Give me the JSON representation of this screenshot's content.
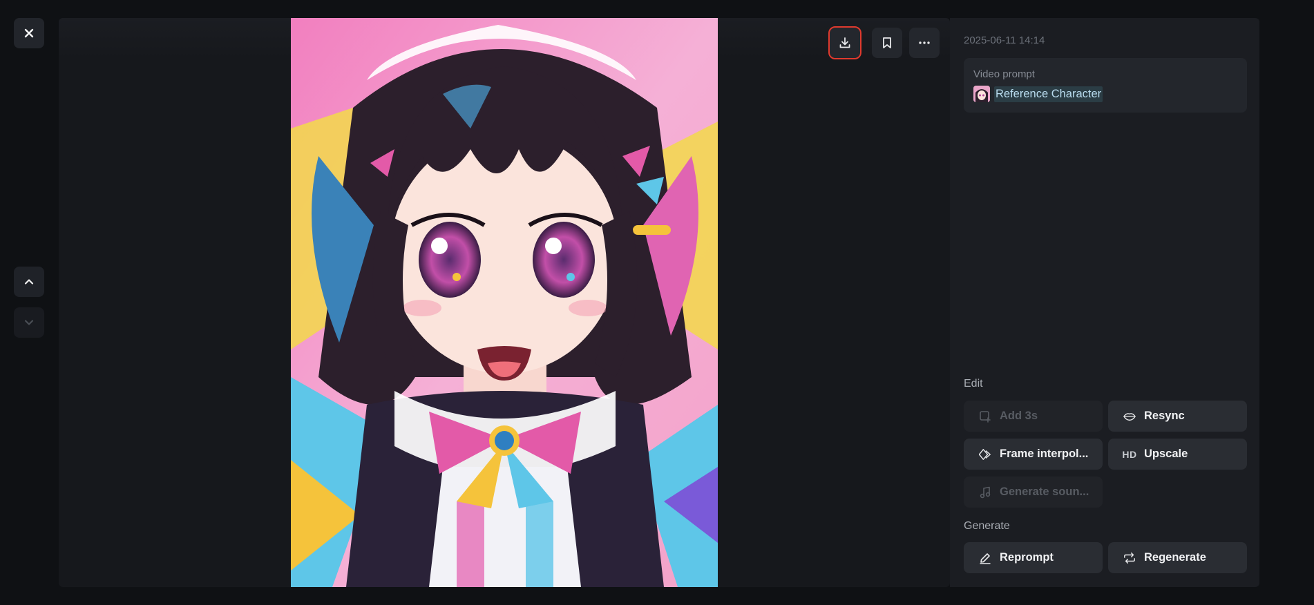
{
  "window": {
    "close_icon": "close-icon",
    "nav_up_icon": "chevron-up-icon",
    "nav_down_icon": "chevron-down-icon"
  },
  "toolbar": {
    "download_icon": "download-icon",
    "bookmark_icon": "bookmark-icon",
    "more_icon": "more-horizontal-icon",
    "highlight_color": "#e03a2e"
  },
  "panel": {
    "timestamp": "2025-06-11 14:14",
    "prompt": {
      "label": "Video prompt",
      "reference": "Reference Character"
    },
    "edit": {
      "title": "Edit",
      "buttons": [
        {
          "label": "Add 3s",
          "icon": "add-clip-icon",
          "enabled": false
        },
        {
          "label": "Resync",
          "icon": "lips-icon",
          "enabled": true
        },
        {
          "label": "Frame interpol...",
          "icon": "diamond-frames-icon",
          "enabled": true
        },
        {
          "label": "Upscale",
          "icon": "HD",
          "enabled": true
        },
        {
          "label": "Generate soun...",
          "icon": "music-note-icon",
          "enabled": false
        }
      ]
    },
    "generate": {
      "title": "Generate",
      "buttons": [
        {
          "label": "Reprompt",
          "icon": "pencil-icon",
          "enabled": true
        },
        {
          "label": "Regenerate",
          "icon": "repeat-icon",
          "enabled": true
        }
      ]
    }
  },
  "colors": {
    "background": "#0f1114",
    "panel": "#1b1d22",
    "button": "#2a2d33",
    "reference_text": "#b9dcef"
  }
}
